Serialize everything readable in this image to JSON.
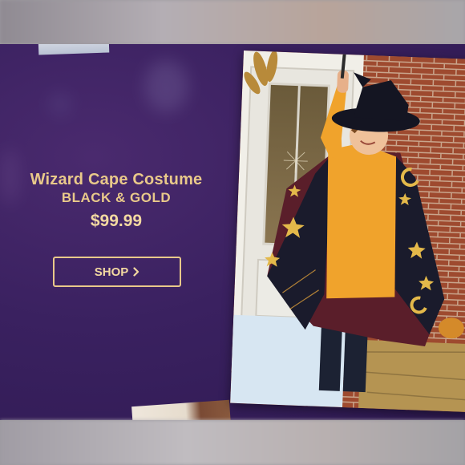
{
  "product": {
    "title": "Wizard Cape Costume",
    "subtitle": "BLACK & GOLD",
    "price": "$99.99"
  },
  "cta": {
    "label": "SHOP",
    "icon": "chevron-right-icon"
  },
  "colors": {
    "banner": "#3a2160",
    "accent_gold": "#e9c98a"
  },
  "images": {
    "hero": "child-in-wizard-cape-and-hat"
  }
}
